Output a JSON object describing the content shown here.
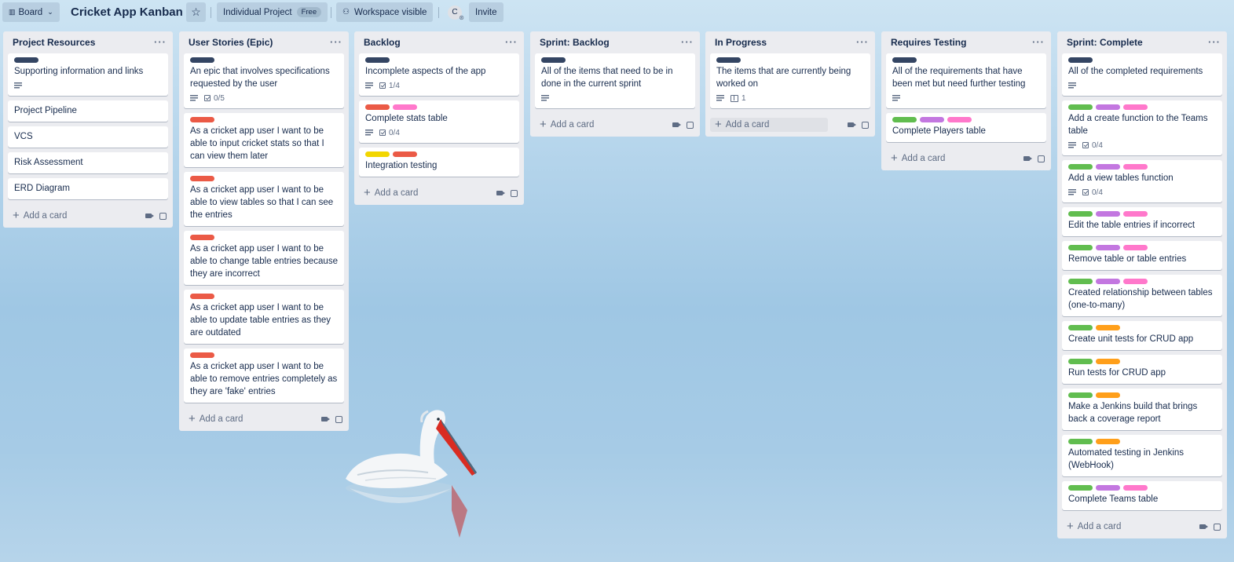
{
  "topbar": {
    "board_btn": "Board",
    "title": "Cricket App Kanban",
    "star": "☆",
    "visibility_team": "Individual Project",
    "plan_pill": "Free",
    "workspace_visible": "Workspace visible",
    "avatar_initial": "C",
    "invite": "Invite"
  },
  "colors": {
    "dark": "#344563",
    "red": "#eb5a46",
    "pink": "#ff78cb",
    "green": "#61bd4f",
    "purple": "#c377e0",
    "yellow": "#f2d600",
    "orange": "#ff9f1a"
  },
  "footer": {
    "add_card": "Add a card"
  },
  "lists": [
    {
      "title": "Project Resources",
      "cards": [
        {
          "labels": [
            "dark"
          ],
          "text": "Supporting information and links",
          "desc": true
        },
        {
          "labels": [],
          "text": "Project Pipeline"
        },
        {
          "labels": [],
          "text": "VCS"
        },
        {
          "labels": [],
          "text": "Risk Assessment"
        },
        {
          "labels": [],
          "text": "ERD Diagram"
        }
      ]
    },
    {
      "title": "User Stories (Epic)",
      "cards": [
        {
          "labels": [
            "dark"
          ],
          "text": "An epic that involves specifications requested by the user",
          "desc": true,
          "checklist": "0/5"
        },
        {
          "labels": [
            "red"
          ],
          "text": "As a cricket app user I want to be able to input cricket stats so that I can view them later"
        },
        {
          "labels": [
            "red"
          ],
          "text": "As a cricket app user I want to be able to view tables so that I can see the entries"
        },
        {
          "labels": [
            "red"
          ],
          "text": "As a cricket app user I want to be able to change table entries because they are incorrect"
        },
        {
          "labels": [
            "red"
          ],
          "text": "As a cricket app user I want to be able to update table entries as they are outdated"
        },
        {
          "labels": [
            "red"
          ],
          "text": "As a cricket app user I want to be able to remove entries completely as they are 'fake' entries"
        }
      ]
    },
    {
      "title": "Backlog",
      "cards": [
        {
          "labels": [
            "dark"
          ],
          "text": "Incomplete aspects of the app",
          "desc": true,
          "checklist": "1/4"
        },
        {
          "labels": [
            "red",
            "pink"
          ],
          "text": "Complete stats table",
          "desc": true,
          "checklist": "0/4"
        },
        {
          "labels": [
            "yellow",
            "red"
          ],
          "text": "Integration testing"
        }
      ]
    },
    {
      "title": "Sprint: Backlog",
      "cards": [
        {
          "labels": [
            "dark"
          ],
          "text": "All of the items that need to be in done in the current sprint",
          "desc": true
        }
      ]
    },
    {
      "title": "In Progress",
      "highlight_add": true,
      "cards": [
        {
          "labels": [
            "dark"
          ],
          "text": "The items that are currently being worked on",
          "desc": true,
          "attach": "1"
        }
      ]
    },
    {
      "title": "Requires Testing",
      "cards": [
        {
          "labels": [
            "dark"
          ],
          "text": "All of the requirements that have been met but need further testing",
          "desc": true
        },
        {
          "labels": [
            "green",
            "purple",
            "pink"
          ],
          "text": "Complete Players table"
        }
      ]
    },
    {
      "title": "Sprint: Complete",
      "cards": [
        {
          "labels": [
            "dark"
          ],
          "text": "All of the completed requirements",
          "desc": true
        },
        {
          "labels": [
            "green",
            "purple",
            "pink"
          ],
          "text": "Add a create function to the Teams table",
          "desc": true,
          "checklist": "0/4"
        },
        {
          "labels": [
            "green",
            "purple",
            "pink"
          ],
          "text": "Add a view tables function",
          "desc": true,
          "checklist": "0/4"
        },
        {
          "labels": [
            "green",
            "purple",
            "pink"
          ],
          "text": "Edit the table entries if incorrect"
        },
        {
          "labels": [
            "green",
            "purple",
            "pink"
          ],
          "text": "Remove table or table entries"
        },
        {
          "labels": [
            "green",
            "purple",
            "pink"
          ],
          "text": "Created relationship between tables (one-to-many)"
        },
        {
          "labels": [
            "green",
            "orange"
          ],
          "text": "Create unit tests for CRUD app"
        },
        {
          "labels": [
            "green",
            "orange"
          ],
          "text": "Run tests for CRUD app"
        },
        {
          "labels": [
            "green",
            "orange"
          ],
          "text": "Make a Jenkins build that brings back a coverage report"
        },
        {
          "labels": [
            "green",
            "orange"
          ],
          "text": "Automated testing in Jenkins (WebHook)"
        },
        {
          "labels": [
            "green",
            "purple",
            "pink"
          ],
          "text": "Complete Teams table"
        }
      ]
    }
  ]
}
